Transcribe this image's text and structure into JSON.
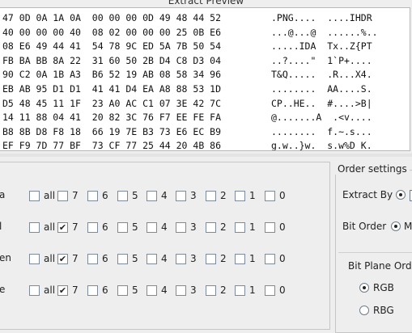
{
  "preview": {
    "title": "Extract Preview",
    "rows": [
      {
        "hex": "47 0D 0A 1A 0A  00 00 00 0D 49 48 44 52",
        "ascii": ".PNG....  ....IHDR"
      },
      {
        "hex": "40 00 00 00 40  08 02 00 00 00 25 0B E6",
        "ascii": "...@...@  ......%.."
      },
      {
        "hex": "08 E6 49 44 41  54 78 9C ED 5A 7B 50 54",
        "ascii": ".....IDA  Tx..Z{PT"
      },
      {
        "hex": "FB BA BB 8A 22  31 60 50 2B D4 C8 D3 04",
        "ascii": "..?....\"  1`P+...."
      },
      {
        "hex": "90 C2 0A 1B A3  B6 52 19 AB 08 58 34 96",
        "ascii": "T&Q.....  .R...X4."
      },
      {
        "hex": "EB AB 95 D1 D1  41 41 D4 EA A8 88 53 1D",
        "ascii": "........  AA....S."
      },
      {
        "hex": "D5 48 45 11 1F  23 A0 AC C1 07 3E 42 7C",
        "ascii": "CP..HE..  #....>B|"
      },
      {
        "hex": "14 11 88 04 41  20 82 3C 76 F7 EE FE FA",
        "ascii": "@.......A  .<v...."
      },
      {
        "hex": "B8 8B D8 F8 18  66 19 7E B3 73 E6 EC B9",
        "ascii": "........  f.~.s..."
      },
      {
        "hex": "EF F9 7D 77 BF  73 CF 77 25 44 20 4B 86",
        "ascii": "g.w..}w.  s.w%D K."
      },
      {
        "hex": "",
        "ascii": ""
      }
    ]
  },
  "bit_planes": {
    "rows": [
      {
        "label": "a",
        "all": false,
        "bits": [
          false,
          false,
          false,
          false,
          false,
          false,
          false,
          false
        ]
      },
      {
        "label": "l",
        "all": false,
        "bits": [
          true,
          false,
          false,
          false,
          false,
          false,
          false,
          false
        ]
      },
      {
        "label": "en",
        "all": false,
        "bits": [
          true,
          false,
          false,
          false,
          false,
          false,
          false,
          false
        ]
      },
      {
        "label": "e",
        "all": false,
        "bits": [
          true,
          false,
          false,
          false,
          false,
          false,
          false,
          false
        ]
      }
    ],
    "all_label": "all",
    "bit_labels": [
      "7",
      "6",
      "5",
      "4",
      "3",
      "2",
      "1",
      "0"
    ]
  },
  "order_settings": {
    "title": "Order settings",
    "extract_by_label": "Extract By",
    "bit_order_label": "Bit Order",
    "bit_order_value": "M",
    "bit_plane_order_label": "Bit Plane Order",
    "plane_options": [
      {
        "label": "RGB",
        "selected": true
      },
      {
        "label": "RBG",
        "selected": false
      }
    ]
  }
}
